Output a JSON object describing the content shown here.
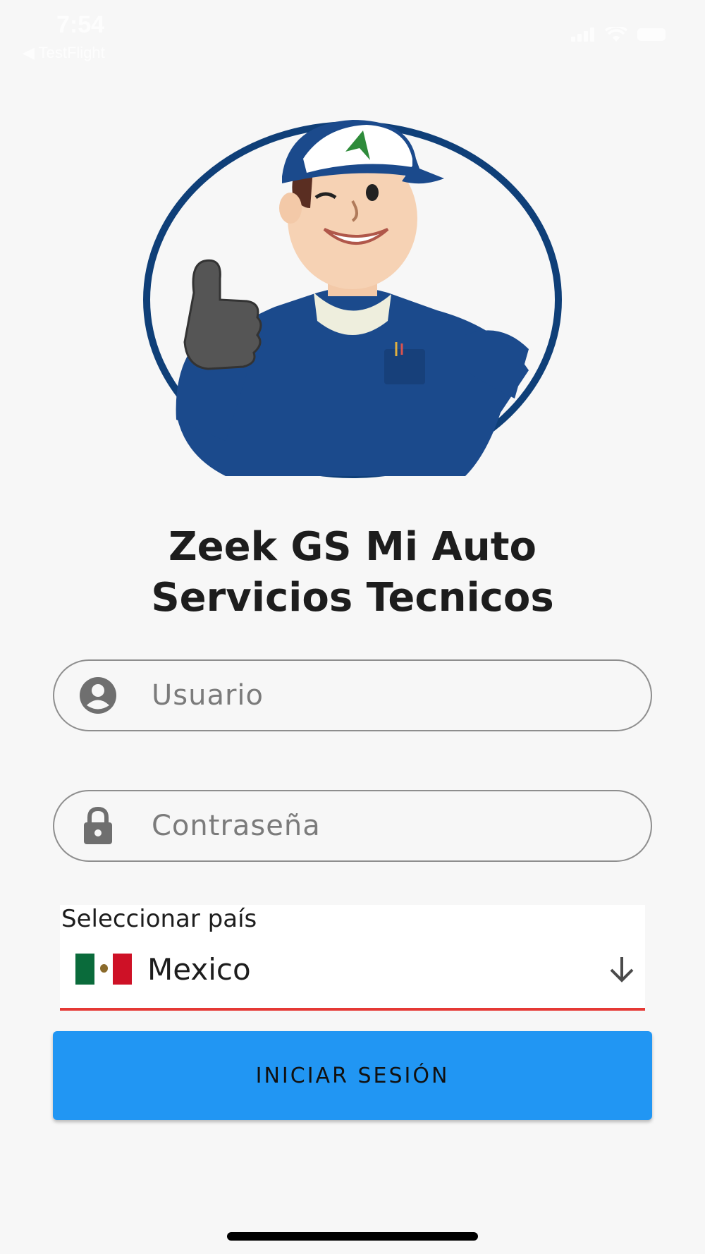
{
  "status_bar": {
    "time": "7:54",
    "back_label": "◀ TestFlight"
  },
  "login": {
    "title_line1": "Zeek GS Mi Auto",
    "title_line2": "Servicios Tecnicos",
    "username_placeholder": "Usuario",
    "password_placeholder": "Contraseña",
    "country_label": "Seleccionar país",
    "country_value": "Mexico",
    "submit_label": "INICIAR SESIÓN"
  },
  "colors": {
    "primary_button": "#2196f3",
    "mascot_ring": "#0f3f78",
    "error_underline": "#e53935"
  },
  "icons": {
    "username": "person-circle-icon",
    "password": "lock-icon",
    "dropdown": "arrow-down-icon",
    "flag": "mexico-flag-icon"
  }
}
